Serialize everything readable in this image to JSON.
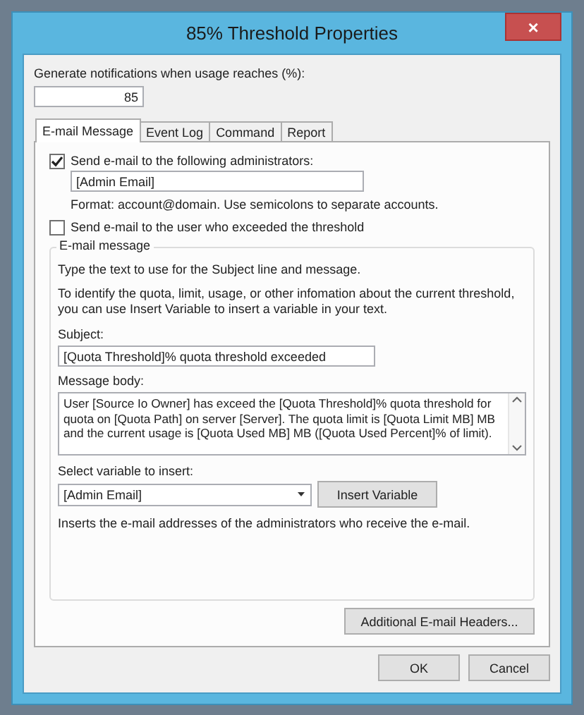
{
  "window": {
    "title": "85% Threshold Properties",
    "close": "×"
  },
  "threshold": {
    "label": "Generate notifications when usage reaches (%):",
    "value": "85"
  },
  "tabs": [
    {
      "label": "E-mail Message",
      "selected": true
    },
    {
      "label": "Event Log",
      "selected": false
    },
    {
      "label": "Command",
      "selected": false
    },
    {
      "label": "Report",
      "selected": false
    }
  ],
  "admin_email": {
    "checked": true,
    "label": "Send e-mail to the following administrators:",
    "value": "[Admin Email]",
    "hint": "Format: account@domain. Use semicolons to separate accounts."
  },
  "user_email": {
    "checked": false,
    "label": "Send e-mail to the user who exceeded the threshold"
  },
  "email_message": {
    "legend": "E-mail message",
    "intro": "Type the text to use for the Subject line and message.",
    "help": "To identify the quota, limit, usage, or other infomation about the current threshold, you can use Insert Variable to insert a variable in your text.",
    "subject_label": "Subject:",
    "subject": "[Quota Threshold]% quota threshold exceeded",
    "body_label": "Message body:",
    "body": "User [Source Io Owner] has exceed the [Quota Threshold]% quota threshold for quota on [Quota Path] on server [Server]. The quota limit is [Quota Limit MB] MB and the current usage is [Quota Used MB] MB ([Quota Used Percent]% of limit).",
    "variable_label": "Select variable to insert:",
    "variable": "[Admin Email]",
    "insert_button": "Insert Variable",
    "variable_help": "Inserts the e-mail addresses of the administrators who receive the e-mail."
  },
  "headers_button": "Additional E-mail Headers...",
  "buttons": [
    "OK",
    "Cancel"
  ]
}
